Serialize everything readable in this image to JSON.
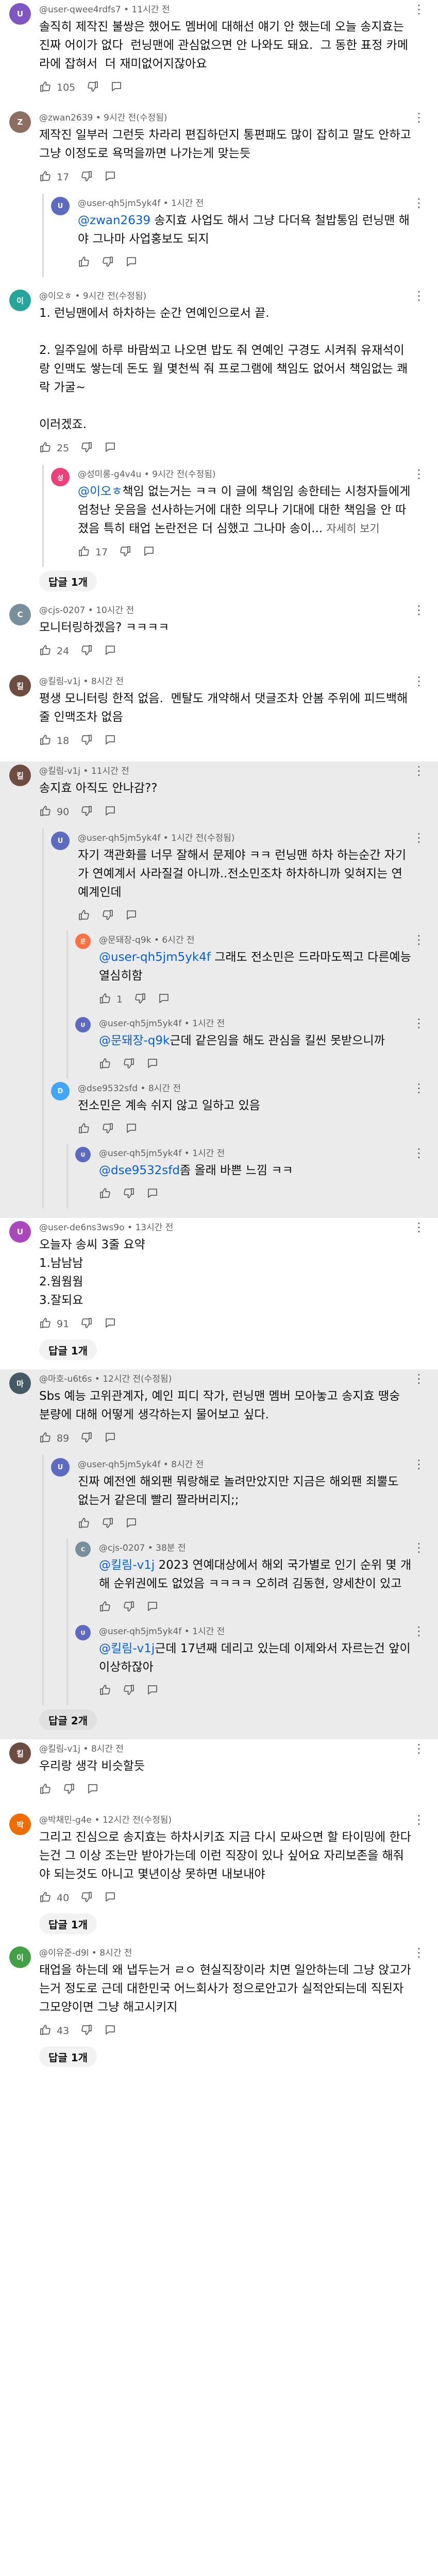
{
  "colors": {
    "mention": "#065fd4",
    "meta": "#606060",
    "highlight_bg": "#ebebeb"
  },
  "icons": {
    "like": "thumbs-up-icon",
    "dislike": "thumbs-down-icon",
    "reply": "reply-icon",
    "menu": "more-vert-icon"
  },
  "threads": [
    {
      "user": "@user-qwee4rdfs7",
      "time": "11시간 전",
      "avatar": {
        "initial": "U",
        "color": "#7e57c2"
      },
      "text": "솔직히 제작진 불쌍은 했어도 멤버에 대해선 얘기 안 했는데 오늘 송지효는 진짜 어이가 없다  런닝맨에 관심없으면 안 나와도 돼요.  그 동한 표정 카메라에 잡혀서  더 재미없어지잖아요",
      "likes": "105",
      "highlight": false
    },
    {
      "user": "@zwan2639",
      "time": "9시간 전(수정됨)",
      "avatar": {
        "initial": "Z",
        "color": "#8d6e63"
      },
      "text": "제작진 일부러 그런듯 차라리 편집하던지 통편패도 많이 잡히고 말도 안하고  그냥 이정도로 욕먹을까면 나가는게 맞는듯",
      "likes": "17",
      "highlight": false,
      "replies": [
        {
          "user": "@user-qh5jm5yk4f",
          "time": "1시간 전",
          "avatar": {
            "initial": "U",
            "color": "#5c6bc0"
          },
          "mention": "@zwan2639",
          "text": " 송지효 사업도 해서 그냥 다더욕 철밥통임 런닝맨 해야 그나마 사업홍보도 되지",
          "likes": ""
        }
      ]
    },
    {
      "user": "@이오ㅎ",
      "time": "9시간 전(수정됨)",
      "avatar": {
        "initial": "이",
        "color": "#26a69a"
      },
      "text": "1. 런닝맨에서 하차하는 순간 연예인으로서 끝.\n\n2. 일주일에 하루 바람쐬고 나오면 밥도 줘 연예인 구경도 시켜줘 유재석이랑 인맥도 쌓는데 돈도 월 몇천씩 줘 프로그램에 책임도 없어서 책임없는 쾌락 가굴~\n\n이러겠죠.",
      "likes": "25",
      "highlight": false,
      "replies": [
        {
          "user": "@성미롱-g4v4u",
          "time": "9시간 전(수정됨)",
          "avatar": {
            "initial": "성",
            "color": "#ec407a"
          },
          "mention": "@이오ㅎ",
          "text": "책임 없는거는 ㅋㅋ 이 글에 책임임 송한테는 시청자들에게 엄청난 웃음을 선사하는거에 대한 의무나 기대에 대한 책임을 안 따졌음 특히 태업 논란전은 더 심했고 그나마 송이...",
          "more": "자세히 보기",
          "likes": "17"
        }
      ],
      "replies_count": "답글 1개"
    },
    {
      "user": "@cjs-0207",
      "time": "10시간 전",
      "avatar": {
        "initial": "C",
        "color": "#78909c"
      },
      "text": "모니터링하겠음? ㅋㅋㅋㅋ",
      "likes": "24",
      "highlight": false
    },
    {
      "user": "@킬림-v1j",
      "time": "8시간 전",
      "avatar": {
        "initial": "킬",
        "color": "#6d4c41"
      },
      "text": "평생 모니터링 한적 없음.  멘탈도 개약해서 댓글조차 안봄 주위에 피드백해줄 인맥조차 없음",
      "likes": "18",
      "highlight": false
    },
    {
      "user": "@킬림-v1j",
      "time": "11시간 전",
      "avatar": {
        "initial": "킬",
        "color": "#6d4c41"
      },
      "text": "송지효 아직도 안나감??",
      "likes": "90",
      "highlight": true,
      "replies": [
        {
          "user": "@user-qh5jm5yk4f",
          "time": "1시간 전(수정됨)",
          "avatar": {
            "initial": "U",
            "color": "#5c6bc0"
          },
          "text": "자기 객관화를 너무 잘해서 문제야 ㅋㅋ 런닝맨 하차 하는순간 자기가 연예계서 사라질걸 아니까..전소민조차 하차하니까 잊혀지는 연예계인데",
          "likes": "",
          "nested": [
            {
              "user": "@문돼장-q9k",
              "time": "6시간 전",
              "avatar": {
                "initial": "문",
                "color": "#ff7043"
              },
              "mention": "@user-qh5jm5yk4f",
              "text": " 그래도 전소민은 드라마도찍고 다른예능 열심히함",
              "likes": "1"
            },
            {
              "user": "@user-qh5jm5yk4f",
              "time": "1시간 전",
              "avatar": {
                "initial": "U",
                "color": "#5c6bc0"
              },
              "mention": "@문돼장-q9k",
              "text": "근데 같은임을 해도 관심을 킬씬 못받으니까",
              "likes": ""
            }
          ]
        },
        {
          "user": "@dse9532sfd",
          "time": "8시간 전",
          "avatar": {
            "initial": "D",
            "color": "#42a5f5"
          },
          "text": "전소민은 계속 쉬지 않고 일하고 있음",
          "likes": "",
          "nested": [
            {
              "user": "@user-qh5jm5yk4f",
              "time": "1시간 전",
              "avatar": {
                "initial": "U",
                "color": "#5c6bc0"
              },
              "mention": "@dse9532sfd",
              "text": "좀 올래 바쁜 느낌 ㅋㅋ",
              "likes": ""
            }
          ]
        }
      ]
    },
    {
      "user": "@user-de6ns3ws9o",
      "time": "13시간 전",
      "avatar": {
        "initial": "U",
        "color": "#ab47bc"
      },
      "text": "오늘자 송씨 3줄 요약\n1.남남남\n2.웜웜웜\n3.잘되요",
      "likes": "91",
      "highlight": false,
      "replies_count": "답글 1개"
    },
    {
      "user": "@마호-u6t6s",
      "time": "12시간 전(수정됨)",
      "avatar": {
        "initial": "마",
        "color": "#455a64"
      },
      "text": "Sbs 예능 고위관계자, 예인 피디 작가, 런닝맨 멤버 모아놓고 송지효 땡숭 분량에 대해 어떻게 생각하는지 물어보고 싶다.",
      "likes": "89",
      "highlight": true,
      "replies": [
        {
          "user": "@user-qh5jm5yk4f",
          "time": "8시간 전",
          "avatar": {
            "initial": "U",
            "color": "#5c6bc0"
          },
          "text": "진짜 예전엔 해외팬 뭐랑해로 놀려만았지만 지금은 해외팬 죄뿔도 없는거 같은데 빨리 짤라버리지;;",
          "likes": "",
          "nested": [
            {
              "user": "@cjs-0207",
              "time": "38분 전",
              "avatar": {
                "initial": "C",
                "color": "#78909c"
              },
              "mention": "@킬림-v1j",
              "text": " 2023 연예대상에서 해외 국가별로 인기 순위 몇 개 해 순위권에도 없었음 ㅋㅋㅋㅋ 오히려 김동현, 양세찬이 있고",
              "likes": ""
            },
            {
              "user": "@user-qh5jm5yk4f",
              "time": "1시간 전",
              "avatar": {
                "initial": "U",
                "color": "#5c6bc0"
              },
              "mention": "@킬림-v1j",
              "text": "근데 17년째 데리고 있는데 이제와서 자르는건 앞이 이상하잖아",
              "likes": ""
            }
          ]
        }
      ],
      "replies_count": "답글 2개"
    },
    {
      "user": "@킬림-v1j",
      "time": "8시간 전",
      "avatar": {
        "initial": "킬",
        "color": "#6d4c41"
      },
      "text": "우리랑 생각 비슷할듯",
      "likes": "",
      "highlight": false
    },
    {
      "user": "@박채민-g4e",
      "time": "12시간 전(수정됨)",
      "avatar": {
        "initial": "박",
        "color": "#ef6c00"
      },
      "text": "그리고 진심으로 송지효는 하차시키죠 지금 다시 모싸으면 할 타이밍에 한다는건 그 이상 조는만 받아가는데 이런 직장이 있나 싶어요 자리보존을 해줘야 되는것도 아니고 몇년이상 못하면 내보내야",
      "likes": "40",
      "highlight": false,
      "replies_count": "답글 1개"
    },
    {
      "user": "@이유준-d9l",
      "time": "8시간 전",
      "avatar": {
        "initial": "이",
        "color": "#43a047"
      },
      "text": "태업을 하는데 왜 냅두는거 ㄹㅇ 현실직장이라 치면 일안하는데 그냥 앉고가는거 정도로 근데 대한민국 어느회사가 정으로안고가 실적안되는데 직된자 그모양이면 그냥 해고시키지",
      "likes": "43",
      "highlight": false,
      "replies_count": "답글 1개"
    }
  ]
}
